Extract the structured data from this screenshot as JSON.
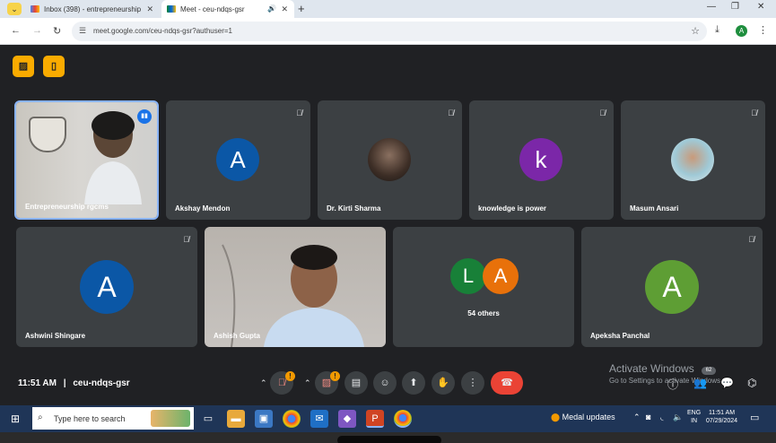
{
  "browser": {
    "tabs": [
      {
        "label": "Inbox (398) - entrepreneurship",
        "favicon": "gmail-icon",
        "active": false
      },
      {
        "label": "Meet - ceu-ndqs-gsr",
        "favicon": "meet-icon",
        "active": true
      }
    ],
    "url": "meet.google.com/ceu-ndqs-gsr?authuser=1",
    "profile_initial": "A"
  },
  "meet": {
    "participants_row1": [
      {
        "name": "Entrepreneurship rgcms",
        "type": "video",
        "speaking": true
      },
      {
        "name": "Akshay Mendon",
        "type": "avatar",
        "initial": "A",
        "color": "#0b57a6",
        "muted": true
      },
      {
        "name": "Dr. Kirti Sharma",
        "type": "photo",
        "muted": true
      },
      {
        "name": "knowledge is power",
        "type": "avatar",
        "initial": "k",
        "color": "#7b27a8",
        "muted": true
      },
      {
        "name": "Masum Ansari",
        "type": "photo",
        "muted": true
      }
    ],
    "participants_row2": [
      {
        "name": "Ashwini Shingare",
        "type": "avatar",
        "initial": "A",
        "color": "#0b57a6",
        "muted": true
      },
      {
        "name": "Ashish Gupta",
        "type": "video",
        "muted": false
      },
      {
        "name": "54 others",
        "type": "group",
        "initials": [
          "L",
          "A"
        ],
        "colors": [
          "#188038",
          "#e8710a"
        ]
      },
      {
        "name": "Apeksha Panchal",
        "type": "avatar",
        "initial": "A",
        "color": "#5e9e34",
        "muted": true
      }
    ],
    "time": "11:51 AM",
    "separator": "|",
    "meeting_code": "ceu-ndqs-gsr",
    "alert_badge": "!",
    "participant_count": "62",
    "activate_title": "Activate Windows",
    "activate_sub": "Go to Settings to activate Windows."
  },
  "taskbar": {
    "search_placeholder": "Type here to search",
    "news": "Medal updates",
    "lang_top": "ENG",
    "lang_bottom": "IN",
    "time": "11:51 AM",
    "date": "07/29/2024"
  }
}
